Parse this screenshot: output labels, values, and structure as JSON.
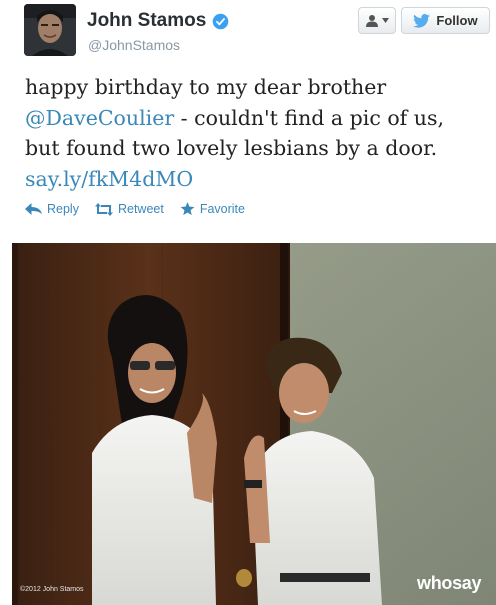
{
  "author": {
    "name": "John Stamos",
    "handle": "@JohnStamos",
    "verified": true
  },
  "header_buttons": {
    "follow_label": "Follow",
    "user_menu_icon": "person-dropdown-icon"
  },
  "tweet": {
    "text_before_mention": "happy birthday to my dear brother",
    "mention": "@DaveCoulier",
    "text_after_mention": " - couldn't find a pic of us, but found two lovely lesbians by a door.",
    "link": "say.ly/fkM4dMO"
  },
  "actions": {
    "reply": "Reply",
    "retweet": "Retweet",
    "favorite": "Favorite"
  },
  "photo": {
    "copyright": "©2012 John Stamos",
    "watermark": "whosay"
  },
  "colors": {
    "link": "#3a88b8",
    "verified": "#3aa1f2",
    "twitter_blue": "#55acee",
    "handle": "#8899a6"
  }
}
